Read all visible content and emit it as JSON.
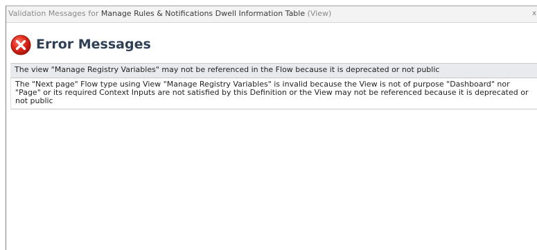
{
  "window": {
    "title_prefix": "Validation Messages for ",
    "title_name": "Manage Rules & Notifications Dwell Information Table",
    "title_suffix": " (View)",
    "close_glyph": "x"
  },
  "header": {
    "icon": "error-icon",
    "icon_color": "#e02a1c",
    "title": "Error Messages"
  },
  "messages": [
    "The view \"Manage Registry Variables\" may not be referenced in the Flow because it is deprecated or not public",
    "The \"Next page\" Flow type using View \"Manage Registry Variables\" is invalid because the View is not of purpose \"Dashboard\" nor \"Page\" or its required Context Inputs are not satisfied by this Definition or the View may not be referenced because it is deprecated or not public"
  ]
}
